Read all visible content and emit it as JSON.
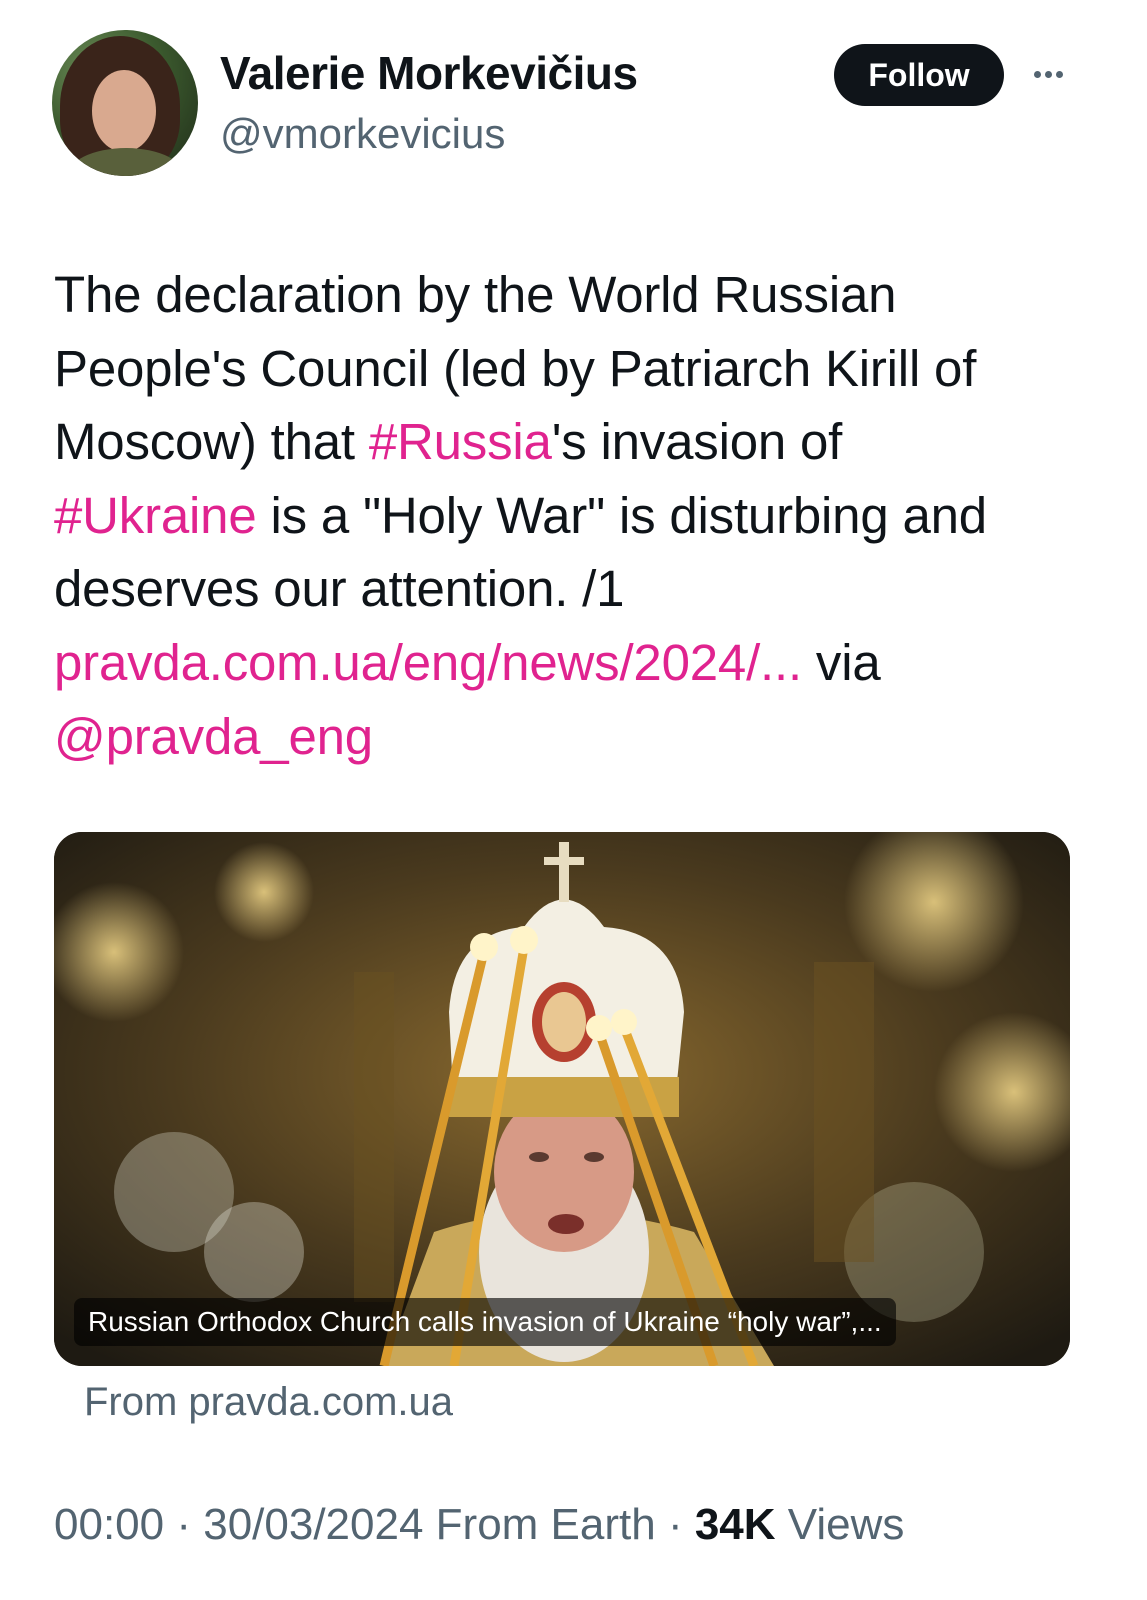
{
  "author": {
    "name": "Valerie Morkevičius",
    "handle": "@vmorkevicius"
  },
  "actions": {
    "follow_label": "Follow",
    "more_icon": "more-horizontal-icon"
  },
  "tweet": {
    "line1": "The declaration by the World Russian",
    "line2": "People's Council (led by Patriarch Kirill of",
    "line3_pre": "Moscow) that ",
    "hashtag_russia": "#Russia",
    "line3_post": "'s invasion of",
    "hashtag_ukraine": "#Ukraine",
    "line4_post": " is a \"Holy War\" is disturbing and",
    "line5": "deserves our attention. /1",
    "link": "pravda.com.ua/eng/news/2024/...",
    "via": " via",
    "mention": "@pravda_eng"
  },
  "card": {
    "caption": "Russian Orthodox Church calls invasion of Ukraine “holy war”,...",
    "source": "From pravda.com.ua"
  },
  "meta": {
    "time": "00:00",
    "sep1": " · ",
    "date": "30/03/2024",
    "from": " From Earth",
    "sep2": " · ",
    "views_count": "34K",
    "views_label": " Views"
  },
  "colors": {
    "accent": "#e0238f",
    "secondary_text": "#536471",
    "button_bg": "#0f1419"
  }
}
